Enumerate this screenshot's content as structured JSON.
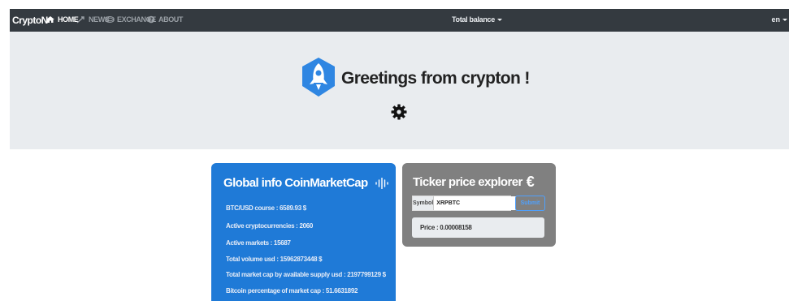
{
  "navbar": {
    "brand": "CryptoN",
    "items": [
      {
        "label": "HOME",
        "icon": "home-icon"
      },
      {
        "label": "NEWS",
        "icon": "news-icon"
      },
      {
        "label": "EXCHANGE",
        "icon": "exchange-icon"
      },
      {
        "label": "ABOUT",
        "icon": "about-icon"
      }
    ],
    "balance": "Total balance",
    "language": "en"
  },
  "jumbotron": {
    "greeting": "Greetings from crypton !"
  },
  "global_info": {
    "title": "Global info CoinMarketCap",
    "lines": [
      "BTC/USD course : 6589.93 $",
      "Active cryptocurrencies : 2060",
      "Active markets : 15687",
      "Total volume usd : 15962873448 $",
      "Total market cap by available supply usd : 2197799129 $",
      "Bitcoin percentage of market cap : 51.6631892"
    ]
  },
  "ticker": {
    "title": "Ticker price explorer",
    "symbol_label": "Symbol",
    "symbol_value": "XRPBTC",
    "submit_label": "Submit",
    "price": "Price : 0.00008158"
  },
  "colors": {
    "navbar": "#343a40",
    "jumbotron": "#e9ecef",
    "global_card": "#1f7ad7",
    "ticker_card": "#808080",
    "submit": "#4ea1ff",
    "rocket_shield": "#2f86e2"
  }
}
